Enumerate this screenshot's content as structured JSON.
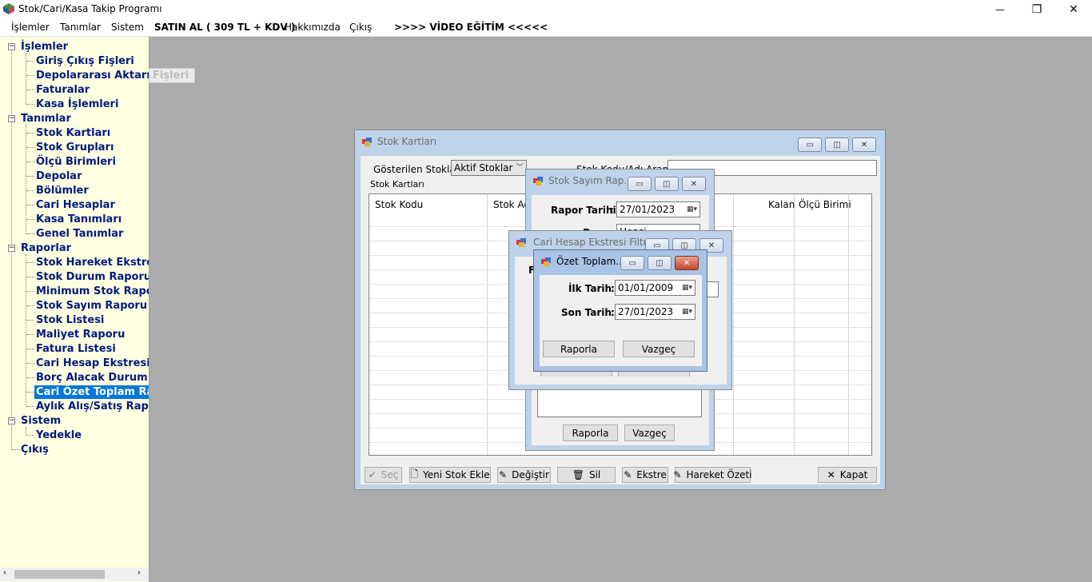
{
  "app": {
    "title": "Stok/Cari/Kasa Takip Programı"
  },
  "window_controls": {
    "minimize": "—",
    "restore": "❐",
    "close": "✕"
  },
  "menu": {
    "items": [
      "İşlemler",
      "Tanımlar",
      "Sistem"
    ],
    "buy": "SATIN AL ( 309 TL + KDV )",
    "about": "Hakkımızda",
    "exit": "Çıkış",
    "video": ">>>> VİDEO EĞİTİM <<<<<"
  },
  "tree": {
    "islemler": {
      "label": "İşlemler",
      "children": [
        "Giriş Çıkış Fişleri",
        "Depolararası Aktarım Fişleri",
        "Faturalar",
        "Kasa İşlemleri"
      ]
    },
    "tanimlar": {
      "label": "Tanımlar",
      "children": [
        "Stok Kartları",
        "Stok Grupları",
        "Ölçü Birimleri",
        "Depolar",
        "Bölümler",
        "Cari Hesaplar",
        "Kasa Tanımları",
        "Genel Tanımlar"
      ]
    },
    "raporlar": {
      "label": "Raporlar",
      "children": [
        "Stok Hareket Ekstresi",
        "Stok Durum Raporu",
        "Minimum Stok Raporu",
        "Stok Sayım Raporu",
        "Stok Listesi",
        "Maliyet Raporu",
        "Fatura Listesi",
        "Cari Hesap Ekstresi",
        "Borç Alacak Durum Raporu",
        "Cari Özet Toplam Raporu",
        "Aylık Alış/Satış Raporu"
      ]
    },
    "sistem": {
      "label": "Sistem",
      "children": [
        "Yedekle"
      ]
    },
    "cikis": {
      "label": "Çıkış"
    },
    "tooltip": "Fişleri"
  },
  "stok_kartlari": {
    "title": "Stok Kartları",
    "shown_label": "Gösterilen Stoklar :",
    "shown_value": "Aktif Stoklar",
    "search_label": "Stok Kodu/Adı Arama :",
    "search_value": "",
    "group_label": "Stok Kartları",
    "columns": [
      "Stok Kodu",
      "Stok Adı",
      "Kalan",
      "Ölçü Birimi"
    ],
    "buttons": {
      "sec": "Seç",
      "yeni": "Yeni Stok Ekle",
      "degistir": "Değiştir",
      "sil": "Sil",
      "ekstre": "Ekstre",
      "hareket": "Hareket Özeti",
      "kapat": "Kapat"
    }
  },
  "stok_sayim": {
    "title": "Stok Sayım Rap...",
    "rapor_tarihi_label": "Rapor Tarihi",
    "rapor_tarihi_value": "27/01/2023",
    "depo_label": "Depo",
    "depo_value": "Hepsi",
    "raporla": "Raporla",
    "vazgec": "Vazgeç"
  },
  "cari_ekstre": {
    "title": "Cari Hesap Ekstresi Filtre",
    "f_label": "F"
  },
  "ozet": {
    "title": "Özet Toplam...",
    "ilk_label": "İlk Tarih",
    "ilk_value": "01/01/2009",
    "son_label": "Son Tarih",
    "son_value": "27/01/2023",
    "raporla": "Raporla",
    "vazgec": "Vazgeç"
  },
  "colors": {
    "tree_bg": "#ffffe1",
    "tree_text": "#001a80",
    "selection": "#0078d7",
    "mdi_bg": "#ababab"
  }
}
